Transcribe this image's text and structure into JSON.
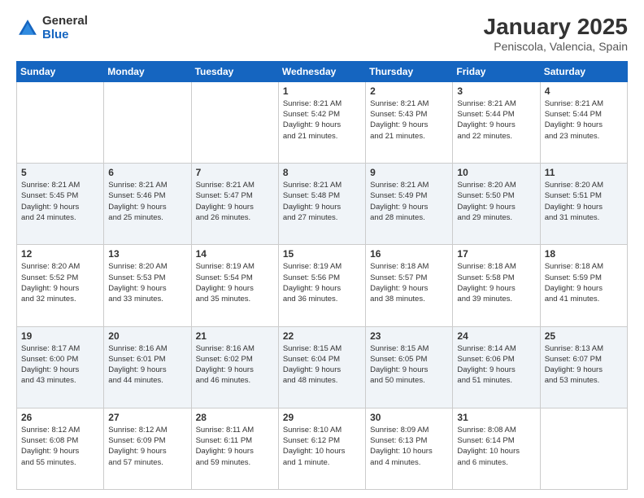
{
  "logo": {
    "general": "General",
    "blue": "Blue"
  },
  "title": "January 2025",
  "subtitle": "Peniscola, Valencia, Spain",
  "days_of_week": [
    "Sunday",
    "Monday",
    "Tuesday",
    "Wednesday",
    "Thursday",
    "Friday",
    "Saturday"
  ],
  "weeks": [
    [
      {
        "day": "",
        "info": ""
      },
      {
        "day": "",
        "info": ""
      },
      {
        "day": "",
        "info": ""
      },
      {
        "day": "1",
        "info": "Sunrise: 8:21 AM\nSunset: 5:42 PM\nDaylight: 9 hours\nand 21 minutes."
      },
      {
        "day": "2",
        "info": "Sunrise: 8:21 AM\nSunset: 5:43 PM\nDaylight: 9 hours\nand 21 minutes."
      },
      {
        "day": "3",
        "info": "Sunrise: 8:21 AM\nSunset: 5:44 PM\nDaylight: 9 hours\nand 22 minutes."
      },
      {
        "day": "4",
        "info": "Sunrise: 8:21 AM\nSunset: 5:44 PM\nDaylight: 9 hours\nand 23 minutes."
      }
    ],
    [
      {
        "day": "5",
        "info": "Sunrise: 8:21 AM\nSunset: 5:45 PM\nDaylight: 9 hours\nand 24 minutes."
      },
      {
        "day": "6",
        "info": "Sunrise: 8:21 AM\nSunset: 5:46 PM\nDaylight: 9 hours\nand 25 minutes."
      },
      {
        "day": "7",
        "info": "Sunrise: 8:21 AM\nSunset: 5:47 PM\nDaylight: 9 hours\nand 26 minutes."
      },
      {
        "day": "8",
        "info": "Sunrise: 8:21 AM\nSunset: 5:48 PM\nDaylight: 9 hours\nand 27 minutes."
      },
      {
        "day": "9",
        "info": "Sunrise: 8:21 AM\nSunset: 5:49 PM\nDaylight: 9 hours\nand 28 minutes."
      },
      {
        "day": "10",
        "info": "Sunrise: 8:20 AM\nSunset: 5:50 PM\nDaylight: 9 hours\nand 29 minutes."
      },
      {
        "day": "11",
        "info": "Sunrise: 8:20 AM\nSunset: 5:51 PM\nDaylight: 9 hours\nand 31 minutes."
      }
    ],
    [
      {
        "day": "12",
        "info": "Sunrise: 8:20 AM\nSunset: 5:52 PM\nDaylight: 9 hours\nand 32 minutes."
      },
      {
        "day": "13",
        "info": "Sunrise: 8:20 AM\nSunset: 5:53 PM\nDaylight: 9 hours\nand 33 minutes."
      },
      {
        "day": "14",
        "info": "Sunrise: 8:19 AM\nSunset: 5:54 PM\nDaylight: 9 hours\nand 35 minutes."
      },
      {
        "day": "15",
        "info": "Sunrise: 8:19 AM\nSunset: 5:56 PM\nDaylight: 9 hours\nand 36 minutes."
      },
      {
        "day": "16",
        "info": "Sunrise: 8:18 AM\nSunset: 5:57 PM\nDaylight: 9 hours\nand 38 minutes."
      },
      {
        "day": "17",
        "info": "Sunrise: 8:18 AM\nSunset: 5:58 PM\nDaylight: 9 hours\nand 39 minutes."
      },
      {
        "day": "18",
        "info": "Sunrise: 8:18 AM\nSunset: 5:59 PM\nDaylight: 9 hours\nand 41 minutes."
      }
    ],
    [
      {
        "day": "19",
        "info": "Sunrise: 8:17 AM\nSunset: 6:00 PM\nDaylight: 9 hours\nand 43 minutes."
      },
      {
        "day": "20",
        "info": "Sunrise: 8:16 AM\nSunset: 6:01 PM\nDaylight: 9 hours\nand 44 minutes."
      },
      {
        "day": "21",
        "info": "Sunrise: 8:16 AM\nSunset: 6:02 PM\nDaylight: 9 hours\nand 46 minutes."
      },
      {
        "day": "22",
        "info": "Sunrise: 8:15 AM\nSunset: 6:04 PM\nDaylight: 9 hours\nand 48 minutes."
      },
      {
        "day": "23",
        "info": "Sunrise: 8:15 AM\nSunset: 6:05 PM\nDaylight: 9 hours\nand 50 minutes."
      },
      {
        "day": "24",
        "info": "Sunrise: 8:14 AM\nSunset: 6:06 PM\nDaylight: 9 hours\nand 51 minutes."
      },
      {
        "day": "25",
        "info": "Sunrise: 8:13 AM\nSunset: 6:07 PM\nDaylight: 9 hours\nand 53 minutes."
      }
    ],
    [
      {
        "day": "26",
        "info": "Sunrise: 8:12 AM\nSunset: 6:08 PM\nDaylight: 9 hours\nand 55 minutes."
      },
      {
        "day": "27",
        "info": "Sunrise: 8:12 AM\nSunset: 6:09 PM\nDaylight: 9 hours\nand 57 minutes."
      },
      {
        "day": "28",
        "info": "Sunrise: 8:11 AM\nSunset: 6:11 PM\nDaylight: 9 hours\nand 59 minutes."
      },
      {
        "day": "29",
        "info": "Sunrise: 8:10 AM\nSunset: 6:12 PM\nDaylight: 10 hours\nand 1 minute."
      },
      {
        "day": "30",
        "info": "Sunrise: 8:09 AM\nSunset: 6:13 PM\nDaylight: 10 hours\nand 4 minutes."
      },
      {
        "day": "31",
        "info": "Sunrise: 8:08 AM\nSunset: 6:14 PM\nDaylight: 10 hours\nand 6 minutes."
      },
      {
        "day": "",
        "info": ""
      }
    ]
  ]
}
